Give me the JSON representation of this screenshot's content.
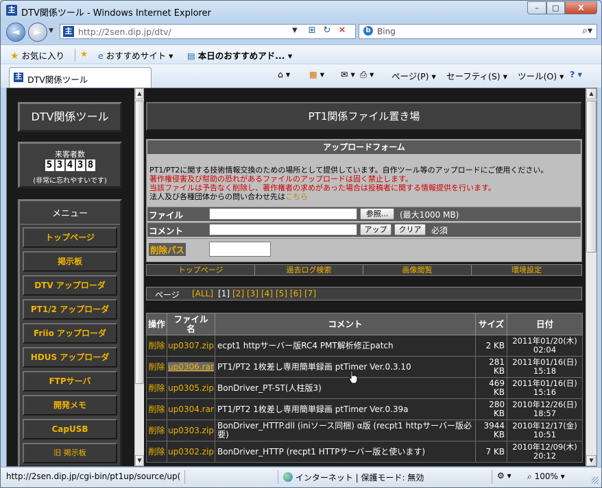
{
  "window": {
    "title": "DTV関係ツール - Windows Internet Explorer",
    "btn_min": "–",
    "btn_max": "□",
    "btn_close": "X"
  },
  "nav": {
    "url": "http://2sen.dip.jp/dtv/",
    "search_placeholder": "Bing",
    "back": "◄",
    "forward": "►"
  },
  "favorites": {
    "fav_label": "お気に入り",
    "suggested": "おすすめサイト ▾",
    "today": "本日のおすすめアド...  ▾"
  },
  "tab": {
    "label": "DTV関係ツール"
  },
  "commands": {
    "page": "ページ(P) ▾",
    "safety": "セーフティ(S) ▾",
    "tools": "ツール(O) ▾"
  },
  "sidebar": {
    "logo": "DTV関係ツール",
    "counter_label": "来客者数",
    "counter_digits": [
      "5",
      "3",
      "4",
      "3",
      "8"
    ],
    "counter_note": "(非常に忘れやすいです)",
    "menu_title": "メニュー",
    "menu_items": [
      "トップページ",
      "掲示板",
      "DTV アップローダ",
      "PT1/2 アップローダ",
      "Friio アップローダ",
      "HDUS アップローダ",
      "FTPサーバ",
      "開発メモ",
      "CapUSB",
      "旧 掲示板"
    ]
  },
  "main": {
    "title": "PT1関係ファイル置き場",
    "form_title": "アップロードフォーム",
    "notice1": "PT1/PT2に関する技術情報交換のための場所として提供しています。自作ツール等のアップロードにご使用ください。",
    "notice2": "著作権侵害及び幇助の恐れがあるファイルのアップロードは固く禁止します。",
    "notice3": "当該ファイルは予告なく削除し、著作権者の求めがあった場合は投稿者に関する情報提供を行います。",
    "notice4": "法人及び各種団体からの問い合わせ先は",
    "notice4_link": "こちら",
    "file_label": "ファイル",
    "browse_btn": "参照...",
    "max_note": "(最大1000 MB)",
    "comment_label": "コメント",
    "upload_btn": "アップ",
    "clear_btn": "クリア",
    "required_note": "必須",
    "delpass_label": "削除パス",
    "subnav": [
      "トップページ",
      "過去ログ検索",
      "画像閲覧",
      "環境設定"
    ],
    "pager_label": "ページ",
    "pages": [
      "[ALL]",
      "[1]",
      "[2]",
      "[3]",
      "[4]",
      "[5]",
      "[6]",
      "[7]"
    ],
    "table_headers": {
      "op": "操作",
      "fname_1": "ファイル",
      "fname_2": "名",
      "comment": "コメント",
      "size": "サイズ",
      "date": "日付"
    },
    "rows": [
      {
        "op": "削除",
        "file": "up0307.zip",
        "comment": "ecpt1 httpサーバー版RC4 PMT解析修正patch",
        "size": "2 KB",
        "date1": "2011年01/20(木)",
        "date2": "02:04"
      },
      {
        "op": "削除",
        "file": "up0306.rar",
        "comment": "PT1/PT2 1枚差し専用簡単録画 ptTimer Ver.0.3.10",
        "size": "281 KB",
        "date1": "2011年01/16(日)",
        "date2": "15:18"
      },
      {
        "op": "削除",
        "file": "up0305.zip",
        "comment": "BonDriver_PT-ST(人柱版3)",
        "size": "469 KB",
        "date1": "2011年01/16(日)",
        "date2": "15:16"
      },
      {
        "op": "削除",
        "file": "up0304.rar",
        "comment": "PT1/PT2 1枚差し専用簡単録画 ptTimer Ver.0.39a",
        "size": "280 KB",
        "date1": "2010年12/26(日)",
        "date2": "18:57"
      },
      {
        "op": "削除",
        "file": "up0303.zip",
        "comment": "BonDriver_HTTP.dll (iniソース同梱) α版 (recpt1 httpサーバー版必要)",
        "size": "3944 KB",
        "date1": "2010年12/17(金)",
        "date2": "10:51"
      },
      {
        "op": "削除",
        "file": "up0302.zip",
        "comment": "BonDriver_HTTP (recpt1 HTTPサーバー版と使います)",
        "size": "7 KB",
        "date1": "2010年12/09(木)",
        "date2": "20:12"
      }
    ]
  },
  "status": {
    "url": "http://2sen.dip.jp/cgi-bin/pt1up/source/up(",
    "zone": "インターネット | 保護モード: 無効",
    "zoom": "100%"
  }
}
